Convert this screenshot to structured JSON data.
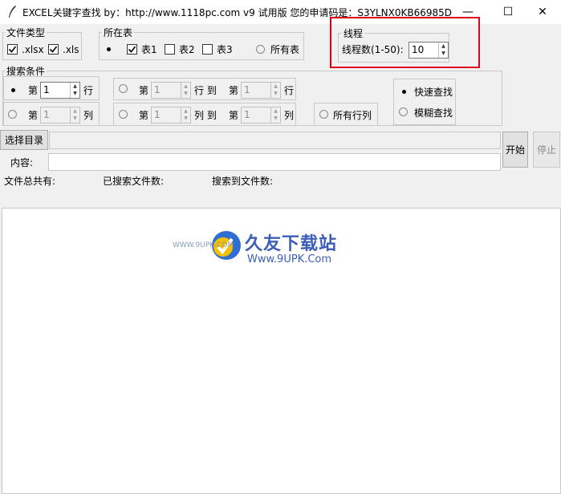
{
  "window": {
    "title": "EXCEL关键字查找   by：http://www.1118pc.com v9 试用版 您的申请码是：S3YLNX0KB66985D",
    "min_symbol": "—",
    "max_symbol": "☐",
    "close_symbol": "✕"
  },
  "file_type": {
    "label": "文件类型",
    "xlsx": {
      "label": ".xlsx",
      "checked": true
    },
    "xls": {
      "label": ".xls",
      "checked": true
    }
  },
  "sheet": {
    "label": "所在表",
    "sheet1": {
      "label": "表1",
      "checked": true
    },
    "sheet2": {
      "label": "表2",
      "checked": false
    },
    "sheet3": {
      "label": "表3",
      "checked": false
    },
    "all": {
      "label": "所有表"
    }
  },
  "thread": {
    "label": "线程",
    "count_label": "线程数(1-50):",
    "count_value": "10"
  },
  "search": {
    "label": "搜索条件",
    "row_single": {
      "prefix": "第",
      "value": "1",
      "suffix": "行"
    },
    "col_single": {
      "prefix": "第",
      "value": "1",
      "suffix": "列"
    },
    "row_range": {
      "prefix": "第",
      "from": "1",
      "mid": "行 到",
      "prefix2": "第",
      "to": "1",
      "suffix": "行"
    },
    "col_range": {
      "prefix": "第",
      "from": "1",
      "mid": "列 到",
      "prefix2": "第",
      "to": "1",
      "suffix": "列"
    },
    "all_rows_cols": "所有行列",
    "fast": "快速查找",
    "fuzzy": "模糊查找"
  },
  "actions": {
    "choose_dir": "选择目录",
    "content_label": "内容:",
    "start": "开始",
    "stop": "停止"
  },
  "status": {
    "total": "文件总共有:",
    "searched": "已搜索文件数:",
    "found": "搜索到文件数:"
  },
  "watermark": {
    "brand": "久友下载站",
    "url": "Www.9UPK.Com",
    "small": "WWW.9UPK.COM"
  }
}
